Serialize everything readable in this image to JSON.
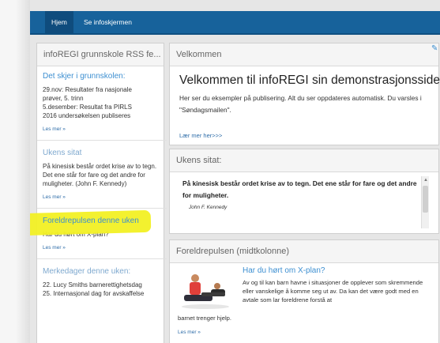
{
  "nav": {
    "home": "Hjem",
    "screen": "Se infoskjermen"
  },
  "left": {
    "panel_title": "infoREGI grunnskole RSS fe...",
    "section1": {
      "title": "Det skjer i grunnskolen:",
      "lines": [
        "29.nov: Resultater fra nasjonale",
        "prøver, 5. trinn",
        "5.desember: Resultat fra PIRLS",
        "2016 undersøkelsen publiseres"
      ],
      "more": "Les mer »"
    },
    "section2": {
      "title": "Ukens sitat",
      "text": "På kinesisk består ordet krise av to tegn. Det ene står for fare og det andre for muligheter. (John F. Kennedy)",
      "more": "Les mer »"
    },
    "section3": {
      "title": "Foreldrepulsen denne uken",
      "text": "Har du hørt om X-plan?",
      "more": "Les mer »"
    },
    "section4": {
      "title": "Merkedager denne uken:",
      "lines": [
        "22. Lucy Smiths barnerettighetsdag",
        "25. Internasjonal dag for avskaffelse"
      ]
    }
  },
  "welcome": {
    "panel_title": "Velkommen",
    "heading": "Velkommen til infoREGI sin demonstrasjonsside.",
    "text": "Her ser du eksempler på publisering. Alt du ser oppdateres automatisk. Du varsles i \"Søndagsmailen\".",
    "more": "Lær mer her>>>"
  },
  "quote": {
    "panel_title": "Ukens sitat:",
    "text": "På kinesisk består ordet krise av to tegn. Det ene står for fare og det andre for muligheter.",
    "author": "John F. Kennedy"
  },
  "parent": {
    "panel_title": "Foreldrepulsen (midtkolonne)",
    "title": "Har du hørt om X-plan?",
    "text": "Av og til kan barn havne i situasjoner de opplever som skremmende eller vanskelige å komme seg ut av. Da kan det være godt med en avtale som lar foreldrene forstå at",
    "text2": "barnet trenger hjelp.",
    "more": "Les mer »"
  },
  "colors": {
    "nav": "#17629b",
    "accent": "#3d8fd1",
    "highlight": "#f2f024"
  },
  "icons": {
    "edit": "pencil-icon",
    "scroll": "scroll-up-icon"
  }
}
